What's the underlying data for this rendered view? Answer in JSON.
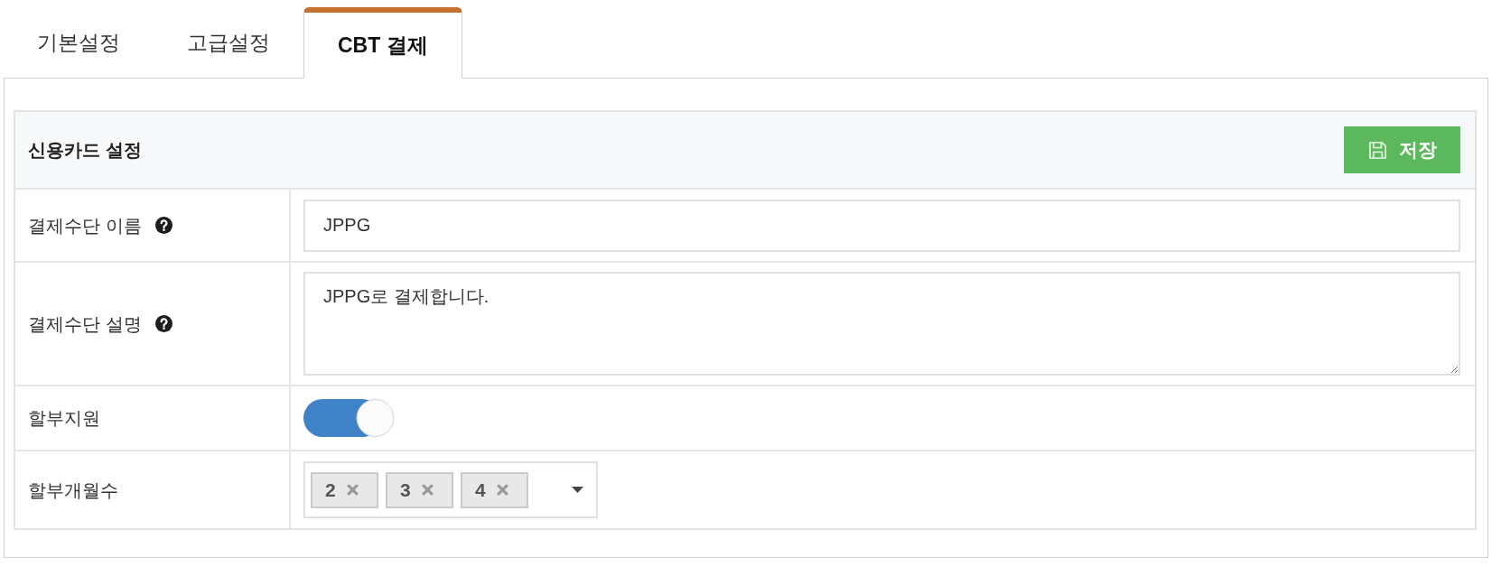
{
  "tabs": [
    {
      "label": "기본설정",
      "selected": false
    },
    {
      "label": "고급설정",
      "selected": false
    },
    {
      "label": "CBT 결제",
      "selected": true
    }
  ],
  "panel": {
    "title": "신용카드 설정",
    "save_button": "저장"
  },
  "fields": [
    {
      "kind": "text",
      "label": "결제수단 이름",
      "help": true,
      "value": "JPPG"
    },
    {
      "kind": "textarea",
      "label": "결제수단 설명",
      "help": true,
      "value": "JPPG로 결제합니다."
    },
    {
      "kind": "toggle",
      "label": "할부지원",
      "on": true
    },
    {
      "kind": "tags",
      "label": "할부개월수",
      "tags": [
        "2",
        "3",
        "4"
      ]
    }
  ]
}
